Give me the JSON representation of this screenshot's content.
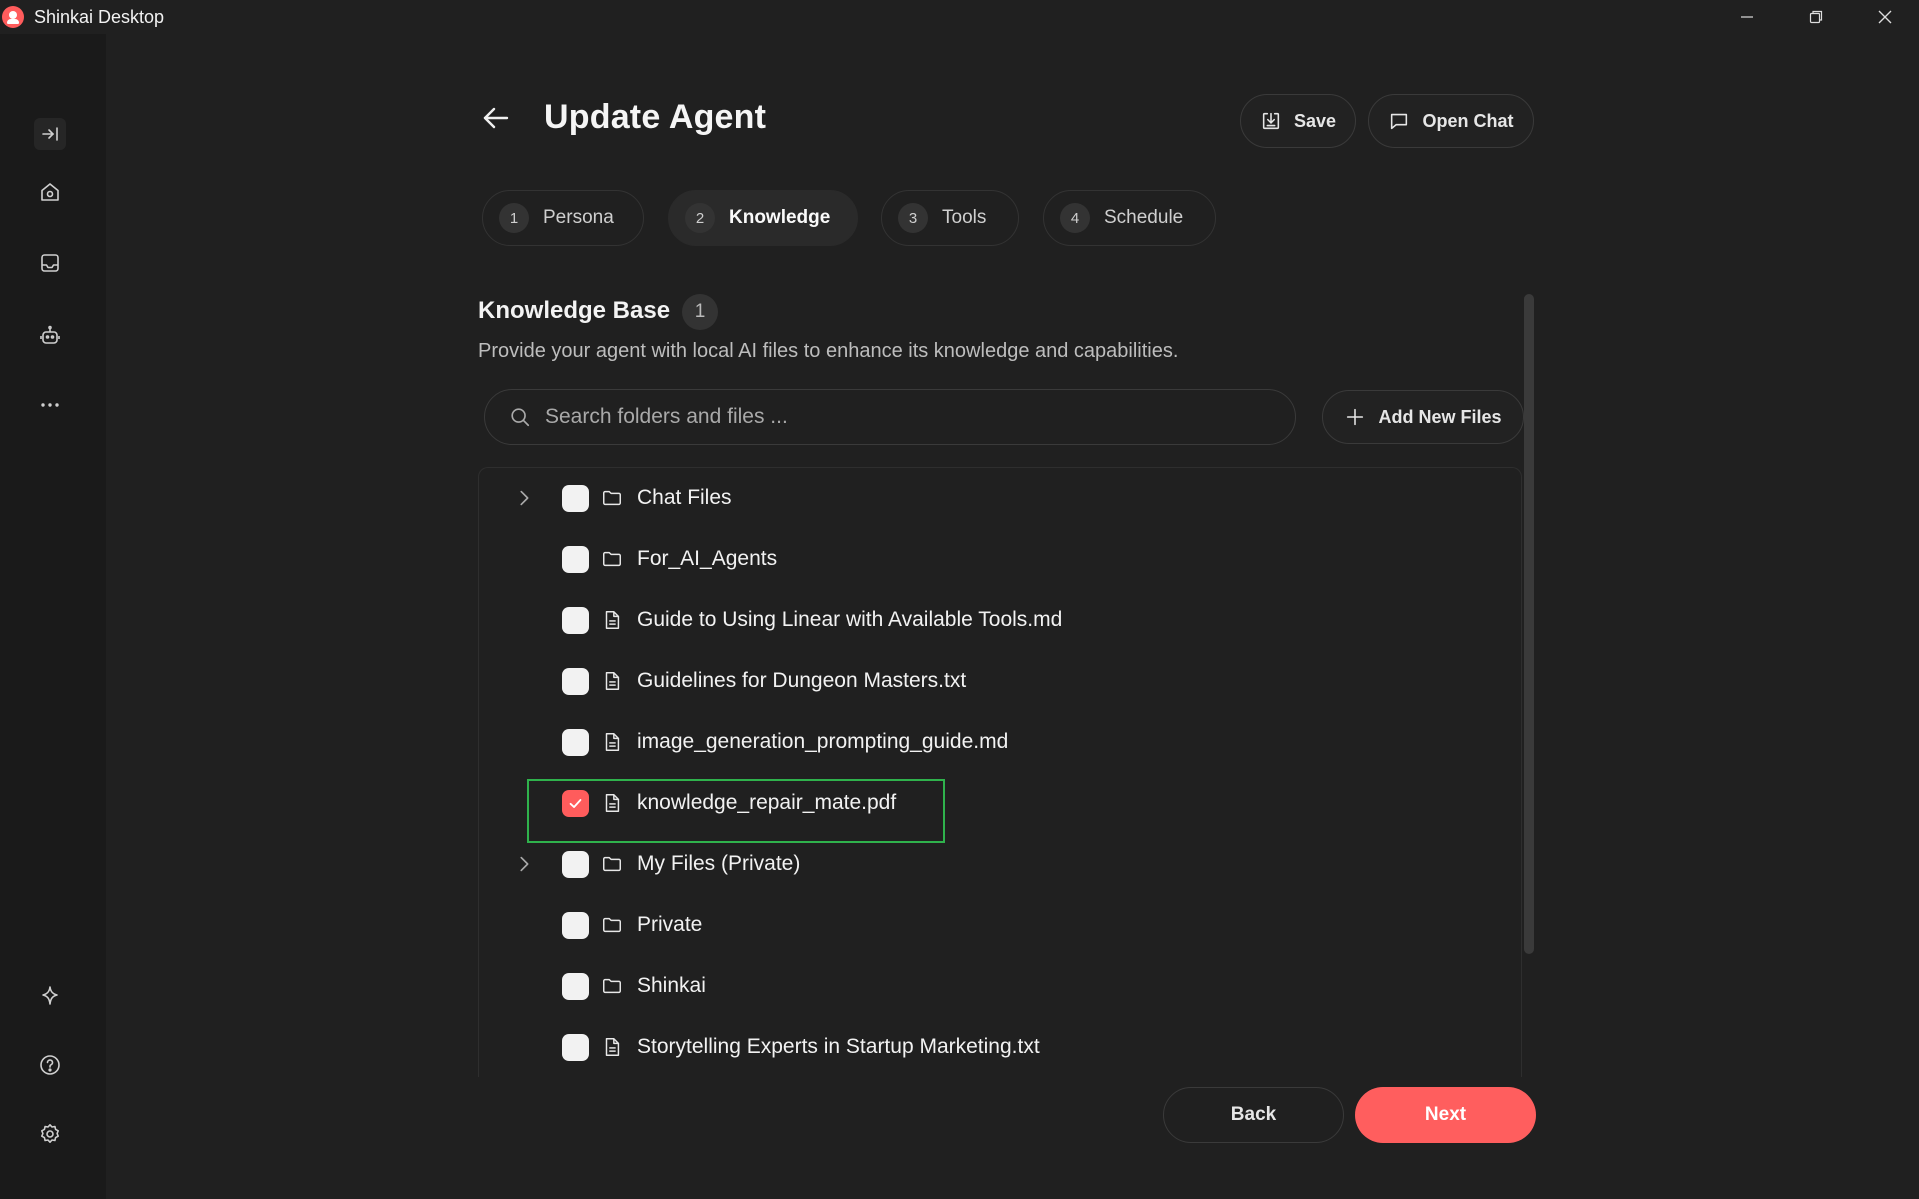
{
  "window": {
    "title": "Shinkai Desktop",
    "controls": [
      "minimize-icon",
      "restore-icon",
      "close-icon"
    ]
  },
  "sidebar": {
    "top_icons": [
      "collapse-sidebar-icon",
      "home-icon",
      "inbox-icon",
      "agent-robot-icon",
      "more-dots-icon"
    ],
    "bottom_icons": [
      "sparkle-icon",
      "help-icon",
      "settings-gear-icon"
    ]
  },
  "header": {
    "title": "Update Agent",
    "save_label": "Save",
    "open_chat_label": "Open Chat"
  },
  "tabs": [
    {
      "num": "1",
      "label": "Persona",
      "active": false
    },
    {
      "num": "2",
      "label": "Knowledge",
      "active": true
    },
    {
      "num": "3",
      "label": "Tools",
      "active": false
    },
    {
      "num": "4",
      "label": "Schedule",
      "active": false
    }
  ],
  "knowledge": {
    "title": "Knowledge Base",
    "count": "1",
    "description": "Provide your agent with local AI files to enhance its knowledge and capabilities.",
    "search_placeholder": "Search folders and files ...",
    "add_files_label": "Add New Files"
  },
  "files": [
    {
      "name": "Chat Files",
      "type": "folder",
      "expandable": true,
      "checked": false
    },
    {
      "name": "For_AI_Agents",
      "type": "folder",
      "expandable": false,
      "checked": false
    },
    {
      "name": "Guide to Using Linear with Available Tools.md",
      "type": "file",
      "expandable": false,
      "checked": false
    },
    {
      "name": "Guidelines for Dungeon Masters.txt",
      "type": "file",
      "expandable": false,
      "checked": false
    },
    {
      "name": "image_generation_prompting_guide.md",
      "type": "file",
      "expandable": false,
      "checked": false
    },
    {
      "name": "knowledge_repair_mate.pdf",
      "type": "file",
      "expandable": false,
      "checked": true
    },
    {
      "name": "My Files (Private)",
      "type": "folder",
      "expandable": true,
      "checked": false
    },
    {
      "name": "Private",
      "type": "folder",
      "expandable": false,
      "checked": false
    },
    {
      "name": "Shinkai",
      "type": "folder",
      "expandable": false,
      "checked": false
    },
    {
      "name": "Storytelling Experts in Startup Marketing.txt",
      "type": "file",
      "expandable": false,
      "checked": false
    }
  ],
  "footer": {
    "back_label": "Back",
    "next_label": "Next"
  },
  "colors": {
    "accent": "#ff5e5e",
    "background": "#202020",
    "sidebar": "#1a1a1a",
    "highlight_box": "#2fb24c"
  }
}
